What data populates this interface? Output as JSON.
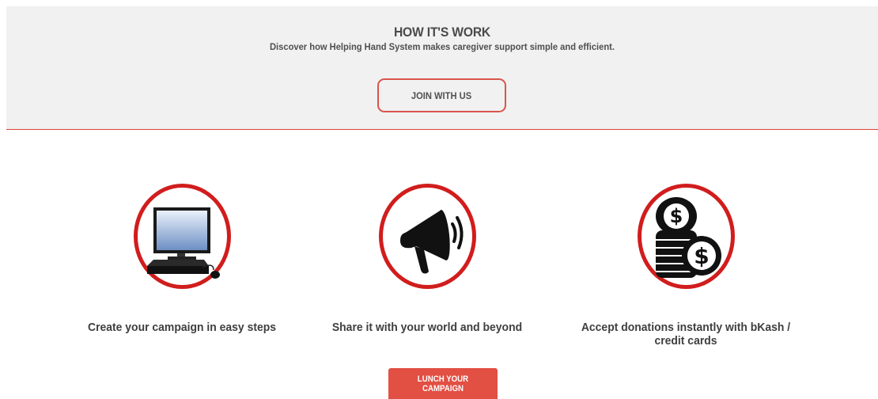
{
  "hero": {
    "title": "HOW IT'S WORK",
    "subtitle": "Discover how Helping Hand System makes caregiver support simple and efficient.",
    "join_label": "JOIN WITH US"
  },
  "steps": [
    {
      "icon": "computer-icon",
      "label": "Create your campaign in easy steps"
    },
    {
      "icon": "megaphone-icon",
      "label": "Share it with your world and beyond"
    },
    {
      "icon": "coins-icon",
      "label": "Accept donations instantly with bKash / credit cards"
    }
  ],
  "launch_label": "LUNCH YOUR CAMPAIGN",
  "colors": {
    "accent": "#e24f43",
    "circle_border": "#d11d1d",
    "hero_bg": "#f1f1f1"
  }
}
